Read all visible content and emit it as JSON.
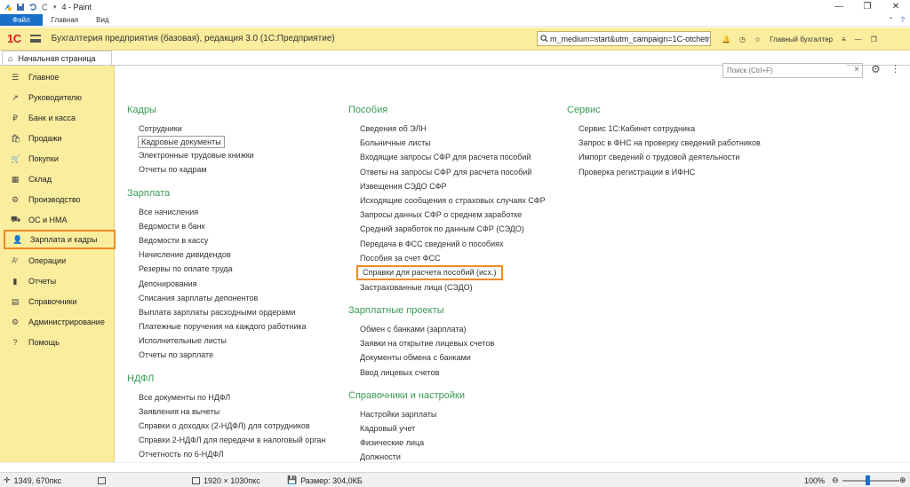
{
  "paint": {
    "title": "4 - Paint",
    "tabs": [
      "Файл",
      "Главная",
      "Вид"
    ],
    "window_controls": [
      "—",
      "❐",
      "✕"
    ]
  },
  "onec": {
    "logo": "1С",
    "app_title": "Бухгалтерия предприятия (базовая), редакция 3.0  (1С:Предприятие)",
    "search_value": "m_medium=start&utm_campaign=1C-otchetn",
    "user": "Главный бухгалтер",
    "home_tab": "Начальная страница"
  },
  "sidebar": {
    "items": [
      {
        "icon": "☰",
        "label": "Главное"
      },
      {
        "icon": "↗",
        "label": "Руководителю"
      },
      {
        "icon": "₽",
        "label": "Банк и касса"
      },
      {
        "icon": "🛍",
        "label": "Продажи"
      },
      {
        "icon": "🛒",
        "label": "Покупки"
      },
      {
        "icon": "▦",
        "label": "Склад"
      },
      {
        "icon": "⚙",
        "label": "Производство"
      },
      {
        "icon": "⛟",
        "label": "ОС и НМА"
      },
      {
        "icon": "👤",
        "label": "Зарплата и кадры"
      },
      {
        "icon": "Дт",
        "label": "Операции"
      },
      {
        "icon": "▮",
        "label": "Отчеты"
      },
      {
        "icon": "▤",
        "label": "Справочники"
      },
      {
        "icon": "⚙",
        "label": "Администрирование"
      },
      {
        "icon": "?",
        "label": "Помощь"
      }
    ]
  },
  "content": {
    "search_placeholder": "Поиск (Ctrl+F)",
    "col1": {
      "kadry_title": "Кадры",
      "kadry": [
        "Сотрудники",
        "Кадровые документы",
        "Электронные трудовые книжки",
        "Отчеты по кадрам"
      ],
      "zarplata_title": "Зарплата",
      "zarplata": [
        "Все начисления",
        "Ведомости в банк",
        "Ведомости в кассу",
        "Начисление дивидендов",
        "Резервы по оплате труда",
        "Депонирования",
        "Списания зарплаты депонентов",
        "Выплата зарплаты расходными ордерами",
        "Платежные поручения на каждого работника",
        "Исполнительные листы",
        "Отчеты по зарплате"
      ],
      "ndfl_title": "НДФЛ",
      "ndfl": [
        "Все документы по НДФЛ",
        "Заявления на вычеты",
        "Справки о доходах (2-НДФЛ) для сотрудников",
        "Справки 2-НДФЛ для передачи в налоговый орган",
        "Отчетность по 6-НДФЛ"
      ]
    },
    "col2": {
      "posobiya_title": "Пособия",
      "posobiya": [
        "Сведения об ЭЛН",
        "Больничные листы",
        "Входящие запросы СФР для расчета пособий",
        "Ответы на запросы СФР для расчета пособий",
        "Извещения СЭДО СФР",
        "Исходящие сообщения о страховых случаях СФР",
        "Запросы данных СФР о среднем заработке",
        "Средний заработок по данным СФР (СЭДО)",
        "Передача в ФСС сведений о пособиях",
        "Пособия за счет ФСС",
        "Справки для расчета пособий (исх.)",
        "Застрахованные лица (СЭДО)"
      ],
      "projects_title": "Зарплатные проекты",
      "projects": [
        "Обмен с банками (зарплата)",
        "Заявки на открытие лицевых счетов",
        "Документы обмена с банками",
        "Ввод лицевых счетов"
      ],
      "settings_title": "Справочники и настройки",
      "settings": [
        "Настройки зарплаты",
        "Кадровый учет",
        "Физические лица",
        "Должности"
      ]
    },
    "col3": {
      "service_title": "Сервис",
      "service": [
        "Сервис 1С:Кабинет сотрудника",
        "Запрос в ФНС на проверку сведений работников",
        "Импорт сведений о трудовой деятельности",
        "Проверка регистрации в ИФНС"
      ]
    }
  },
  "status": {
    "cursor": "1349, 670пкс",
    "dimensions": "1920 × 1030пкс",
    "size": "Размер: 304,0КБ",
    "zoom": "100%"
  },
  "colors": {
    "onec_yellow": "#fbed9e",
    "section_green": "#3a9a55",
    "highlight_orange": "#f08a24",
    "paint_blue": "#1a6fc9"
  }
}
